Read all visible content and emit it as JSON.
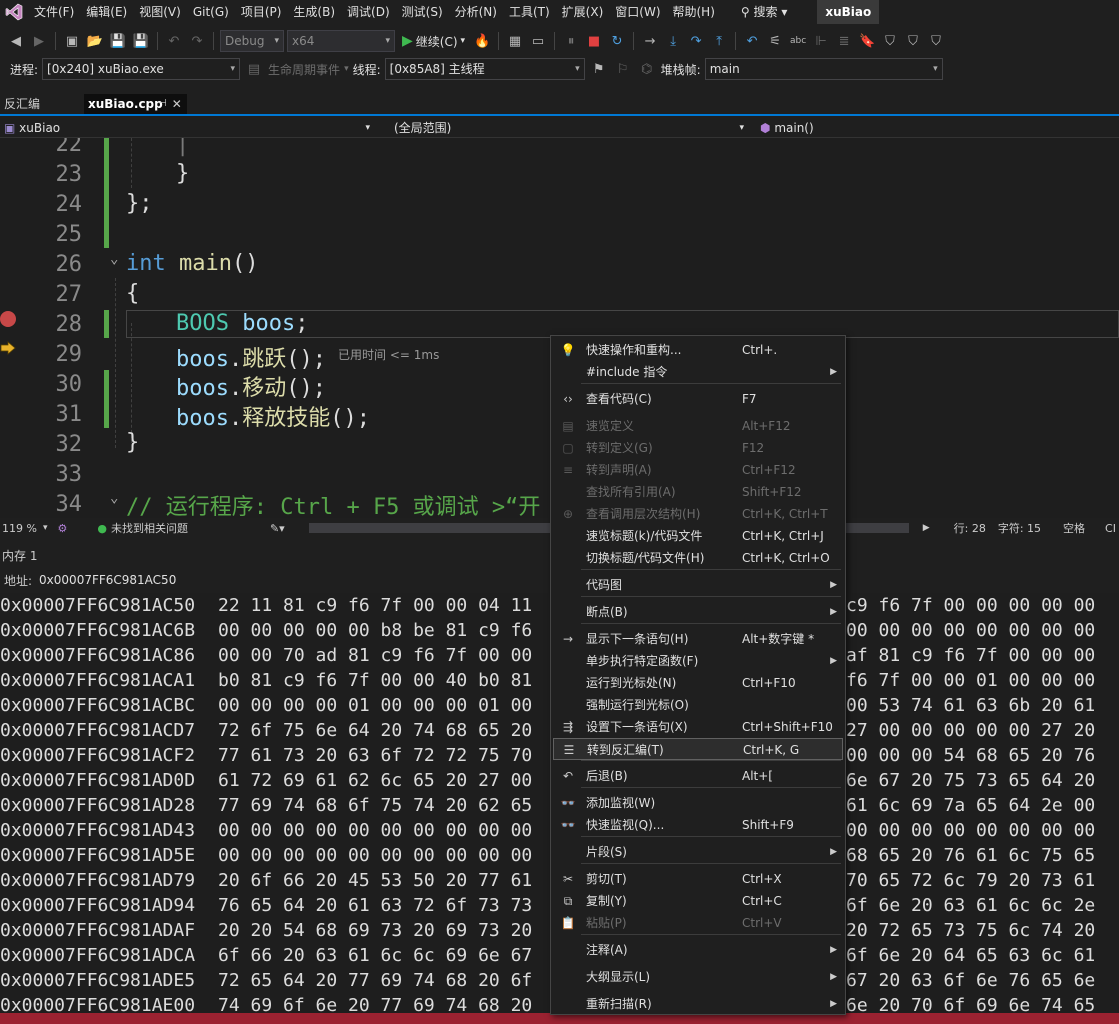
{
  "menubar": {
    "items": [
      "文件(F)",
      "编辑(E)",
      "视图(V)",
      "Git(G)",
      "项目(P)",
      "生成(B)",
      "调试(D)",
      "测试(S)",
      "分析(N)",
      "工具(T)",
      "扩展(X)",
      "窗口(W)",
      "帮助(H)"
    ],
    "search": "搜索",
    "title": "xuBiao"
  },
  "toolbar": {
    "config": "Debug",
    "platform": "x64",
    "continue": "继续(C)"
  },
  "debugbar": {
    "process_label": "进程:",
    "process": "[0x240] xuBiao.exe",
    "lifecycle": "生命周期事件",
    "thread_label": "线程:",
    "thread": "[0x85A8] 主线程",
    "stack_label": "堆栈帧:",
    "stack": "main"
  },
  "tabs": {
    "disasm": "反汇编",
    "file": "xuBiao.cpp",
    "pin": "⊣",
    "close": "✕"
  },
  "navbar": {
    "project": "xuBiao",
    "scope": "(全局范围)",
    "member": "main()"
  },
  "editor": {
    "line_numbers": [
      "22",
      "23",
      "24",
      "25",
      "26",
      "27",
      "28",
      "29",
      "30",
      "31",
      "32",
      "33",
      "34"
    ],
    "lines": {
      "l22": "|",
      "l23": "}",
      "l24": "};",
      "l26_kw": "int",
      "l26_fn": "main",
      "l26_rest": "()",
      "l27": "{",
      "l28_ty": "BOOS",
      "l28_var": "boos",
      "l28_end": ";",
      "l29_var": "boos",
      "l29_fn": "跳跃",
      "l29_end": "();",
      "l30_var": "boos",
      "l30_fn": "移动",
      "l30_end": "();",
      "l31_var": "boos",
      "l31_fn": "释放技能",
      "l31_end": "();",
      "l32": "}",
      "l34": "// 运行程序: Ctrl + F5 或调试 >“开"
    },
    "perf_tip": "已用时间 <= 1ms"
  },
  "status": {
    "zoom": "119 %",
    "issues": "未找到相关问题",
    "line": "行: 28",
    "col": "字符: 15",
    "spaces": "空格",
    "enc": "CI"
  },
  "memory": {
    "title": "内存 1",
    "addr_label": "地址:",
    "addr": "0x00007FF6C981AC50",
    "rows": [
      {
        "a": "0x00007FF6C981AC50",
        "b1": "22 11 81 c9 f6 7f 00 00 04 11",
        "b2": "c9 f6 7f 00 00 00 00 00"
      },
      {
        "a": "0x00007FF6C981AC6B",
        "b1": "00 00 00 00 00 b8 be 81 c9 f6",
        "b2": "00 00 00 00 00 00 00 00"
      },
      {
        "a": "0x00007FF6C981AC86",
        "b1": "00 00 70 ad 81 c9 f6 7f 00 00",
        "b2": "af 81 c9 f6 7f 00 00 00"
      },
      {
        "a": "0x00007FF6C981ACA1",
        "b1": "b0 81 c9 f6 7f 00 00 40 b0 81",
        "b2": "f6 7f 00 00 01 00 00 00"
      },
      {
        "a": "0x00007FF6C981ACBC",
        "b1": "00 00 00 00 01 00 00 00 01 00",
        "b2": "00 53 74 61 63 6b 20 61"
      },
      {
        "a": "0x00007FF6C981ACD7",
        "b1": "72 6f 75 6e 64 20 74 68 65 20",
        "b2": "27 00 00 00 00 00 27 20"
      },
      {
        "a": "0x00007FF6C981ACF2",
        "b1": "77 61 73 20 63 6f 72 72 75 70",
        "b2": "00 00 00 54 68 65 20 76"
      },
      {
        "a": "0x00007FF6C981AD0D",
        "b1": "61 72 69 61 62 6c 65 20 27 00",
        "b2": "6e 67 20 75 73 65 64 20"
      },
      {
        "a": "0x00007FF6C981AD28",
        "b1": "77 69 74 68 6f 75 74 20 62 65",
        "b2": "61 6c 69 7a 65 64 2e 00"
      },
      {
        "a": "0x00007FF6C981AD43",
        "b1": "00 00 00 00 00 00 00 00 00 00",
        "b2": "00 00 00 00 00 00 00 00"
      },
      {
        "a": "0x00007FF6C981AD5E",
        "b1": "00 00 00 00 00 00 00 00 00 00",
        "b2": "68 65 20 76 61 6c 75 65"
      },
      {
        "a": "0x00007FF6C981AD79",
        "b1": "20 6f 66 20 45 53 50 20 77 61",
        "b2": "70 65 72 6c 79 20 73 61"
      },
      {
        "a": "0x00007FF6C981AD94",
        "b1": "76 65 64 20 61 63 72 6f 73 73",
        "b2": "6f 6e 20 63 61 6c 6c 2e"
      },
      {
        "a": "0x00007FF6C981ADAF",
        "b1": "20 20 54 68 69 73 20 69 73 20",
        "b2": "20 72 65 73 75 6c 74 20"
      },
      {
        "a": "0x00007FF6C981ADCA",
        "b1": "6f 66 20 63 61 6c 6c 69 6e 67",
        "b2": "6f 6e 20 64 65 63 6c 61"
      },
      {
        "a": "0x00007FF6C981ADE5",
        "b1": "72 65 64 20 77 69 74 68 20 6f",
        "b2": "67 20 63 6f 6e 76 65 6e"
      },
      {
        "a": "0x00007FF6C981AE00",
        "b1": "74 69 6f 6e 20 77 69 74 68 20",
        "b2": "6e 20 70 6f 69 6e 74 65"
      }
    ]
  },
  "context_menu": {
    "items": [
      {
        "icon": "💡",
        "label": "快速操作和重构...",
        "shortcut": "Ctrl+.",
        "sub": "",
        "dis": false,
        "hl": false
      },
      {
        "icon": "",
        "label": "#include 指令",
        "shortcut": "",
        "sub": "▶",
        "dis": false,
        "hl": false
      },
      {
        "icon": "‹›",
        "label": "查看代码(C)",
        "shortcut": "F7",
        "sub": "",
        "dis": false,
        "hl": false
      },
      {
        "icon": "▤",
        "label": "速览定义",
        "shortcut": "Alt+F12",
        "sub": "",
        "dis": true,
        "hl": false
      },
      {
        "icon": "▢",
        "label": "转到定义(G)",
        "shortcut": "F12",
        "sub": "",
        "dis": true,
        "hl": false
      },
      {
        "icon": "≡",
        "label": "转到声明(A)",
        "shortcut": "Ctrl+F12",
        "sub": "",
        "dis": true,
        "hl": false
      },
      {
        "icon": "",
        "label": "查找所有引用(A)",
        "shortcut": "Shift+F12",
        "sub": "",
        "dis": true,
        "hl": false
      },
      {
        "icon": "⊕",
        "label": "查看调用层次结构(H)",
        "shortcut": "Ctrl+K, Ctrl+T",
        "sub": "",
        "dis": true,
        "hl": false
      },
      {
        "icon": "",
        "label": "速览标题(k)/代码文件",
        "shortcut": "Ctrl+K, Ctrl+J",
        "sub": "",
        "dis": false,
        "hl": false
      },
      {
        "icon": "",
        "label": "切换标题/代码文件(H)",
        "shortcut": "Ctrl+K, Ctrl+O",
        "sub": "",
        "dis": false,
        "hl": false
      },
      {
        "icon": "",
        "label": "代码图",
        "shortcut": "",
        "sub": "▶",
        "dis": false,
        "hl": false
      },
      {
        "icon": "",
        "label": "断点(B)",
        "shortcut": "",
        "sub": "▶",
        "dis": false,
        "hl": false
      },
      {
        "icon": "→",
        "label": "显示下一条语句(H)",
        "shortcut": "Alt+数字键 *",
        "sub": "",
        "dis": false,
        "hl": false
      },
      {
        "icon": "",
        "label": "单步执行特定函数(F)",
        "shortcut": "",
        "sub": "▶",
        "dis": false,
        "hl": false
      },
      {
        "icon": "",
        "label": "运行到光标处(N)",
        "shortcut": "Ctrl+F10",
        "sub": "",
        "dis": false,
        "hl": false
      },
      {
        "icon": "",
        "label": "强制运行到光标(O)",
        "shortcut": "",
        "sub": "",
        "dis": false,
        "hl": false
      },
      {
        "icon": "⇶",
        "label": "设置下一条语句(X)",
        "shortcut": "Ctrl+Shift+F10",
        "sub": "",
        "dis": false,
        "hl": false
      },
      {
        "icon": "☰",
        "label": "转到反汇编(T)",
        "shortcut": "Ctrl+K, G",
        "sub": "",
        "dis": false,
        "hl": true
      },
      {
        "icon": "↶",
        "label": "后退(B)",
        "shortcut": "Alt+[",
        "sub": "",
        "dis": false,
        "hl": false
      },
      {
        "icon": "👓",
        "label": "添加监视(W)",
        "shortcut": "",
        "sub": "",
        "dis": false,
        "hl": false
      },
      {
        "icon": "👓",
        "label": "快速监视(Q)...",
        "shortcut": "Shift+F9",
        "sub": "",
        "dis": false,
        "hl": false
      },
      {
        "icon": "",
        "label": "片段(S)",
        "shortcut": "",
        "sub": "▶",
        "dis": false,
        "hl": false
      },
      {
        "icon": "✂",
        "label": "剪切(T)",
        "shortcut": "Ctrl+X",
        "sub": "",
        "dis": false,
        "hl": false
      },
      {
        "icon": "⧉",
        "label": "复制(Y)",
        "shortcut": "Ctrl+C",
        "sub": "",
        "dis": false,
        "hl": false
      },
      {
        "icon": "📋",
        "label": "粘贴(P)",
        "shortcut": "Ctrl+V",
        "sub": "",
        "dis": true,
        "hl": false
      },
      {
        "icon": "",
        "label": "注释(A)",
        "shortcut": "",
        "sub": "▶",
        "dis": false,
        "hl": false
      },
      {
        "icon": "",
        "label": "大纲显示(L)",
        "shortcut": "",
        "sub": "▶",
        "dis": false,
        "hl": false
      },
      {
        "icon": "",
        "label": "重新扫描(R)",
        "shortcut": "",
        "sub": "▶",
        "dis": false,
        "hl": false
      }
    ]
  }
}
